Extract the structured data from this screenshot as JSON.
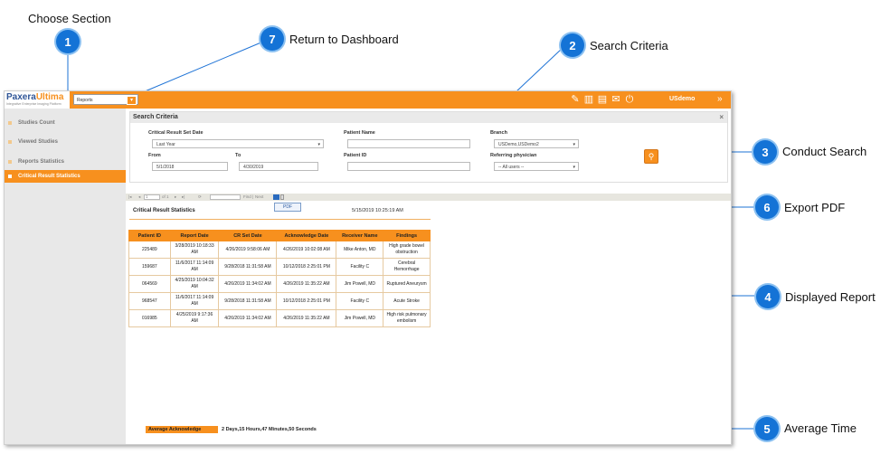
{
  "callouts": [
    {
      "num": "1",
      "label": "Choose Section"
    },
    {
      "num": "7",
      "label": "Return to Dashboard"
    },
    {
      "num": "2",
      "label": "Search Criteria"
    },
    {
      "num": "3",
      "label": "Conduct Search"
    },
    {
      "num": "6",
      "label": "Export PDF"
    },
    {
      "num": "4",
      "label": "Displayed Report"
    },
    {
      "num": "5",
      "label": "Average Time"
    }
  ],
  "app": {
    "logo_name_part1": "Paxera",
    "logo_name_part2": "Ultima",
    "logo_tagline": "Integrative Enterprise Imaging Platform",
    "section_select": "Reports",
    "user": "USdemo",
    "collapse_glyph": "»",
    "top_icons": [
      "edit-icon",
      "bar-chart-icon",
      "folders-icon",
      "mail-icon",
      "power-icon"
    ]
  },
  "sidebar": {
    "items": [
      {
        "label": "Studies Count"
      },
      {
        "label": "Viewed Studies"
      },
      {
        "label": "Reports Statistics"
      },
      {
        "label": "Critical Result Statistics"
      }
    ]
  },
  "search": {
    "title": "Search Criteria",
    "close": "×",
    "set_date_label": "Critical Result Set Date",
    "set_date_value": "Last Year",
    "from_label": "From",
    "from_value": "5/1/2018",
    "to_label": "To",
    "to_value": "4/30/2019",
    "patient_name_label": "Patient Name",
    "patient_name_value": "",
    "patient_id_label": "Patient ID",
    "patient_id_value": "",
    "branch_label": "Branch",
    "branch_value": "USDemo,USDemo2",
    "referring_label": "Referring physician",
    "referring_value": "-- All users --"
  },
  "toolbar": {
    "first": "|◂",
    "prev": "◂",
    "page": "1",
    "of": "of 1",
    "next": "▸",
    "last": "▸|",
    "refresh": "⟳",
    "find": "Find",
    "separator": "|",
    "next_find": "Next",
    "export_option": "PDF"
  },
  "report": {
    "title": "Critical Result Statistics",
    "generated": "5/15/2019 10:25:19 AM",
    "columns": [
      "Patient ID",
      "Report Date",
      "CR Set Date",
      "Acknowledge Date",
      "Receiver Name",
      "Findings"
    ],
    "rows": [
      [
        "225489",
        "3/28/2019 10:18:33 AM",
        "4/26/2019 9:58:06 AM",
        "4/26/2019 10:02:08 AM",
        "Mike Anton, MD",
        "High grade bowel obstruction"
      ],
      [
        "159687",
        "11/6/2017 11:14:09 AM",
        "9/28/2018 11:31:58 AM",
        "10/12/2018 2:25:01 PM",
        "Facility C",
        "Cerebral Hemorrhage"
      ],
      [
        "064569",
        "4/25/2019 10:04:32 AM",
        "4/26/2019 11:34:02 AM",
        "4/26/2019 11:35:22 AM",
        "Jim Powell, MD",
        "Ruptured Aneurysm"
      ],
      [
        "968547",
        "11/6/2017 11:14:09 AM",
        "9/28/2018 11:31:58 AM",
        "10/12/2018 2:25:01 PM",
        "Facility C",
        "Acute Stroke"
      ],
      [
        "016985",
        "4/25/2019 9:17:36 AM",
        "4/26/2019 11:34:02 AM",
        "4/26/2019 11:35:22 AM",
        "Jim Powell, MD",
        "High risk pulmonary embolism"
      ]
    ],
    "avg_label": "Average Acknowledge",
    "avg_value": "2 Days,15 Hours,47 Minutes,50 Seconds"
  },
  "colors": {
    "accent": "#f7901e",
    "callout": "#1473d6",
    "brand_blue": "#2f5597"
  }
}
